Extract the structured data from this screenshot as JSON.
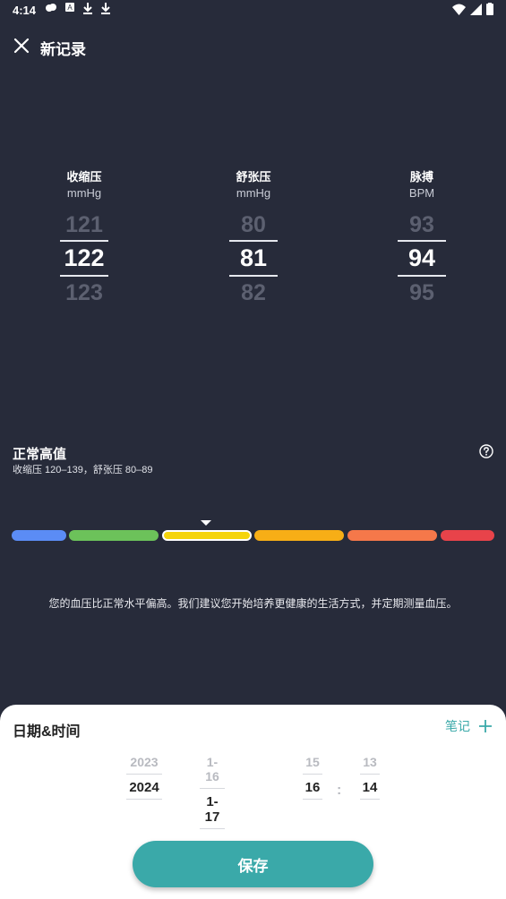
{
  "status_bar": {
    "time": "4:14",
    "left_icons": [
      "weather-icon",
      "app-icon",
      "download-icon",
      "download-icon"
    ],
    "right_icons": [
      "wifi-icon",
      "signal-icon",
      "battery-icon"
    ]
  },
  "header": {
    "title": "新记录",
    "close_icon": "close-icon"
  },
  "pickers": [
    {
      "label": "收缩压",
      "unit": "mmHg",
      "prev": "121",
      "current": "122",
      "next": "123"
    },
    {
      "label": "舒张压",
      "unit": "mmHg",
      "prev": "80",
      "current": "81",
      "next": "82"
    },
    {
      "label": "脉搏",
      "unit": "BPM",
      "prev": "93",
      "current": "94",
      "next": "95"
    }
  ],
  "category": {
    "title": "正常高值",
    "subtitle": "收缩压 120–139，舒张压 80–89",
    "help_icon": "help-circle-icon",
    "selected_index": 2,
    "colors": [
      "#5b8cf5",
      "#6cc25a",
      "#f5d40c",
      "#f7ae16",
      "#f5784a",
      "#e8434a"
    ]
  },
  "advice": "您的血压比正常水平偏高。我们建议您开始培养更健康的生活方式，并定期测量血压。",
  "datetime": {
    "title": "日期&时间",
    "note_label": "笔记",
    "year_prev": "2023",
    "year": "2024",
    "date_prev": "1-16",
    "date": "1-17",
    "hour_prev": "15",
    "hour": "16",
    "minute_prev": "13",
    "minute": "14",
    "separator": ":"
  },
  "save_label": "保存"
}
